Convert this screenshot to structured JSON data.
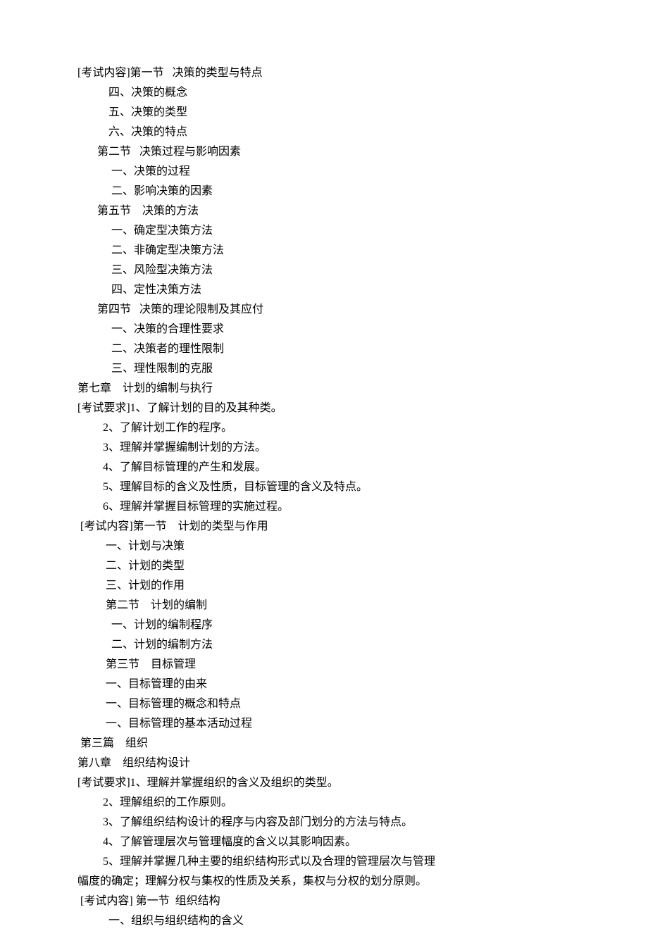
{
  "lines": [
    "[考试内容]第一节   决策的类型与特点",
    "           四、决策的概念",
    "           五、决策的类型",
    "           六、决策的特点",
    "       第二节   决策过程与影响因素",
    "            一、决策的过程",
    "            二、影响决策的因素",
    "       第五节    决策的方法",
    "            一、确定型决策方法",
    "            二、非确定型决策方法",
    "            三、风险型决策方法",
    "            四、定性决策方法",
    "       第四节   决策的理论限制及其应付",
    "            一、决策的合理性要求",
    "            二、决策者的理性限制",
    "            三、理性限制的克服",
    "第七章    计划的编制与执行",
    "[考试要求]1、了解计划的目的及其种类。",
    "         2、了解计划工作的程序。",
    "         3、理解并掌握编制计划的方法。",
    "         4、了解目标管理的产生和发展。",
    "         5、理解目标的含义及性质，目标管理的含义及特点。",
    "         6、理解并掌握目标管理的实施过程。",
    " [考试内容]第一节    计划的类型与作用",
    "          一、计划与决策",
    "          二、计划的类型",
    "          三、计划的作用",
    "          第二节    计划的编制",
    "            一、计划的编制程序",
    "            二、计划的编制方法",
    "          第三节    目标管理",
    "          一、目标管理的由来",
    "          一、目标管理的概念和特点",
    "          一、目标管理的基本活动过程",
    " 第三篇    组织",
    "第八章    组织结构设计",
    "[考试要求]1、理解并掌握组织的含义及组织的类型。",
    "         2、理解组织的工作原则。",
    "         3、了解组织结构设计的程序与内容及部门划分的方法与特点。",
    "         4、了解管理层次与管理幅度的含义以其影响因素。",
    "         5、理解并掌握几种主要的组织结构形式以及合理的管理层次与管理",
    "幅度的确定；理解分权与集权的性质及关系，集权与分权的划分原则。",
    " [考试内容] 第一节  组织结构",
    "           一、组织与组织结构的含义"
  ]
}
